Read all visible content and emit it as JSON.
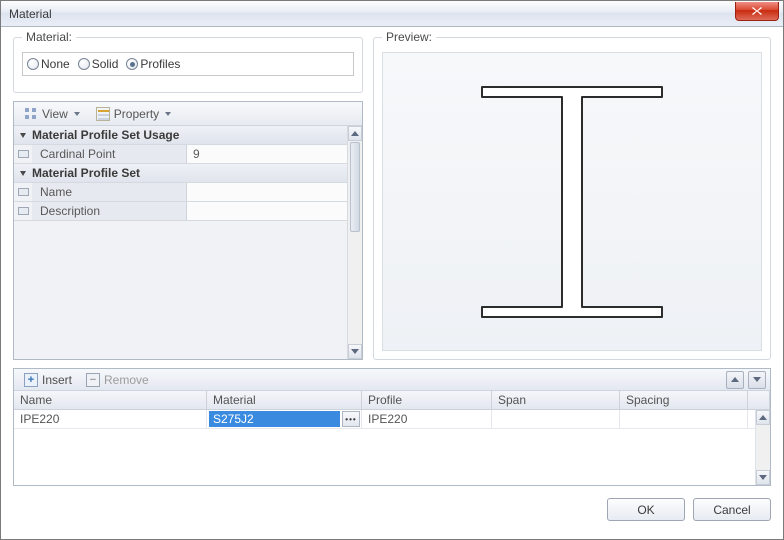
{
  "window": {
    "title": "Material"
  },
  "materialBox": {
    "label": "Material:",
    "options": {
      "none": "None",
      "solid": "Solid",
      "profiles": "Profiles"
    },
    "selected": "profiles"
  },
  "propToolbar": {
    "view": "View",
    "property": "Property"
  },
  "propertyGrid": {
    "group1": "Material Profile Set Usage",
    "rows1": [
      {
        "key": "Cardinal Point",
        "value": "9"
      }
    ],
    "group2": "Material Profile Set",
    "rows2": [
      {
        "key": "Name",
        "value": ""
      },
      {
        "key": "Description",
        "value": ""
      }
    ]
  },
  "preview": {
    "label": "Preview:"
  },
  "listToolbar": {
    "insert": "Insert",
    "remove": "Remove"
  },
  "table": {
    "columns": {
      "name": "Name",
      "material": "Material",
      "profile": "Profile",
      "span": "Span",
      "spacing": "Spacing"
    },
    "rows": [
      {
        "name": "IPE220",
        "material": "S275J2",
        "profile": "IPE220",
        "span": "",
        "spacing": ""
      }
    ]
  },
  "buttons": {
    "ok": "OK",
    "cancel": "Cancel"
  }
}
